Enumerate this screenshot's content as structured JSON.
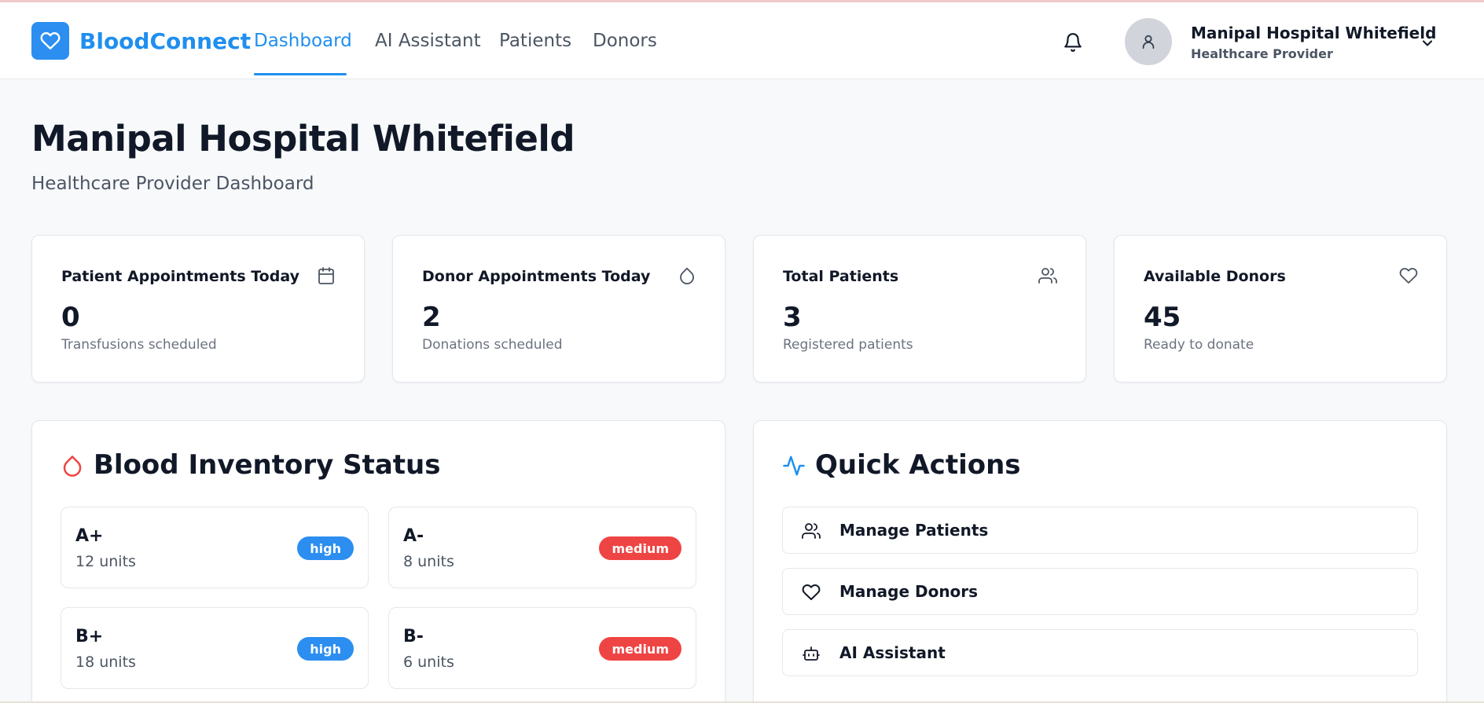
{
  "app": {
    "name": "BloodConnect",
    "accent_color": "#1f8fef",
    "logo_icon": "heart-icon"
  },
  "nav": {
    "items": [
      {
        "label": "Dashboard",
        "active": true
      },
      {
        "label": "AI Assistant",
        "active": false
      },
      {
        "label": "Patients",
        "active": false
      },
      {
        "label": "Donors",
        "active": false
      }
    ]
  },
  "user": {
    "name": "Manipal Hospital Whitefield",
    "role": "Healthcare Provider",
    "icons": [
      "bell-icon",
      "user-icon",
      "chevron-down-icon"
    ]
  },
  "page": {
    "title": "Manipal Hospital Whitefield",
    "subtitle": "Healthcare Provider Dashboard"
  },
  "stats": [
    {
      "title": "Patient Appointments Today",
      "value": "0",
      "desc": "Transfusions scheduled",
      "icon": "calendar-icon"
    },
    {
      "title": "Donor Appointments Today",
      "value": "2",
      "desc": "Donations scheduled",
      "icon": "droplet-icon"
    },
    {
      "title": "Total Patients",
      "value": "3",
      "desc": "Registered patients",
      "icon": "users-icon"
    },
    {
      "title": "Available Donors",
      "value": "45",
      "desc": "Ready to donate",
      "icon": "heart-icon"
    }
  ],
  "inventory": {
    "title": "Blood Inventory Status",
    "icon": "droplet-icon",
    "items": [
      {
        "type": "A+",
        "units": "12 units",
        "level": "high",
        "color": "#2b8ef0"
      },
      {
        "type": "A-",
        "units": "8 units",
        "level": "medium",
        "color": "#ef4444"
      },
      {
        "type": "B+",
        "units": "18 units",
        "level": "high",
        "color": "#2b8ef0"
      },
      {
        "type": "B-",
        "units": "6 units",
        "level": "medium",
        "color": "#ef4444"
      }
    ]
  },
  "quick_actions": {
    "title": "Quick Actions",
    "icon": "activity-icon",
    "items": [
      {
        "label": "Manage Patients",
        "icon": "users-icon"
      },
      {
        "label": "Manage Donors",
        "icon": "heart-icon"
      },
      {
        "label": "AI Assistant",
        "icon": "bot-icon"
      }
    ]
  }
}
